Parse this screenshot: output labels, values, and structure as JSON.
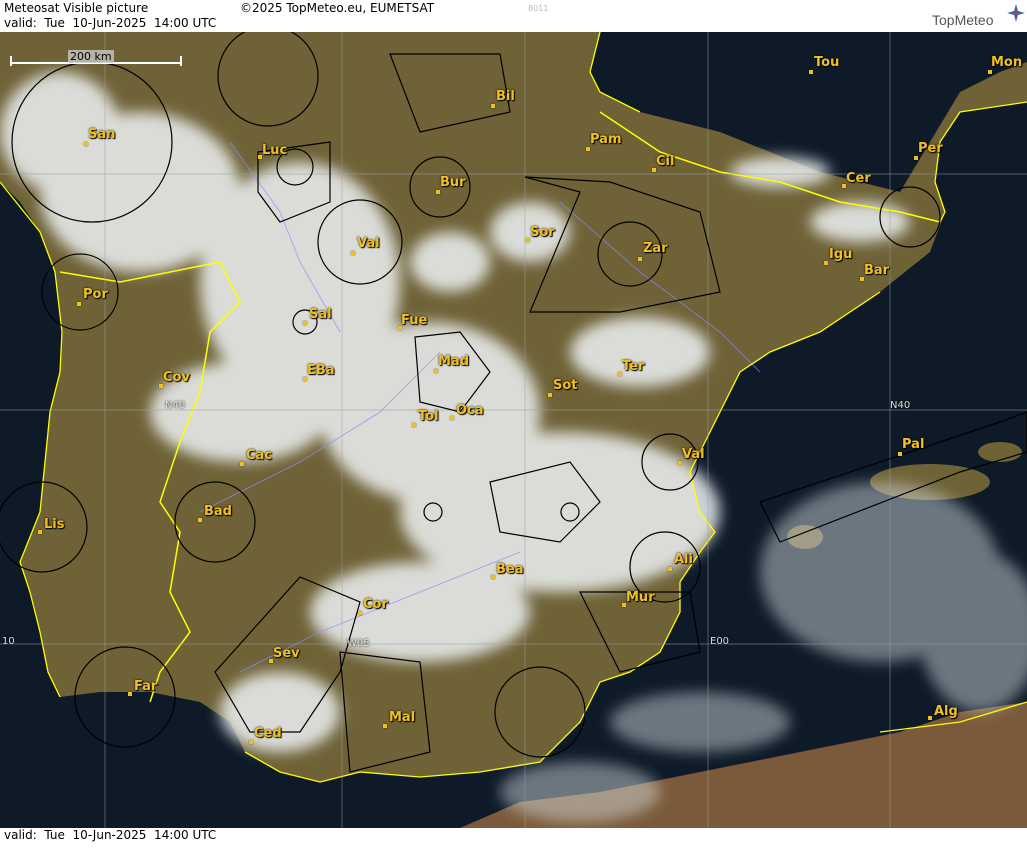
{
  "header": {
    "title": "Meteosat Visible picture",
    "copyright": "©2025 TopMeteo.eu, EUMETSAT",
    "code": "8011",
    "valid": "valid:  Tue  10-Jun-2025  14:00 UTC",
    "logo": "TopMeteo"
  },
  "scale_bar": "200 km",
  "grid_labels": [
    "N40",
    "N40",
    "W05",
    "E00",
    "10"
  ],
  "cities": [
    {
      "name": "San"
    },
    {
      "name": "Luc"
    },
    {
      "name": "Bil"
    },
    {
      "name": "Pam"
    },
    {
      "name": "Cil"
    },
    {
      "name": "Tou"
    },
    {
      "name": "Mon"
    },
    {
      "name": "Per"
    },
    {
      "name": "Cer"
    },
    {
      "name": "Bur"
    },
    {
      "name": "Val"
    },
    {
      "name": "Sor"
    },
    {
      "name": "Zar"
    },
    {
      "name": "Igu"
    },
    {
      "name": "Bar"
    },
    {
      "name": "Por"
    },
    {
      "name": "Sal"
    },
    {
      "name": "Fue"
    },
    {
      "name": "Mad"
    },
    {
      "name": "Cov"
    },
    {
      "name": "EBa"
    },
    {
      "name": "Sot"
    },
    {
      "name": "Ter"
    },
    {
      "name": "Tol"
    },
    {
      "name": "Oca"
    },
    {
      "name": "Pal"
    },
    {
      "name": "Cac"
    },
    {
      "name": "Val"
    },
    {
      "name": "Lis"
    },
    {
      "name": "Bad"
    },
    {
      "name": "Ali"
    },
    {
      "name": "Bea"
    },
    {
      "name": "Mur"
    },
    {
      "name": "Cor"
    },
    {
      "name": "Sev"
    },
    {
      "name": "Far"
    },
    {
      "name": "Ced"
    },
    {
      "name": "Mal"
    },
    {
      "name": "Alg"
    }
  ],
  "footer": {
    "valid": "valid:  Tue  10-Jun-2025  14:00 UTC"
  },
  "colors": {
    "land": "#7a6a3a",
    "sea": "#0d1a2a",
    "cloud": "#e8ecef",
    "border": "#ffff33",
    "label": "#f0c020"
  }
}
